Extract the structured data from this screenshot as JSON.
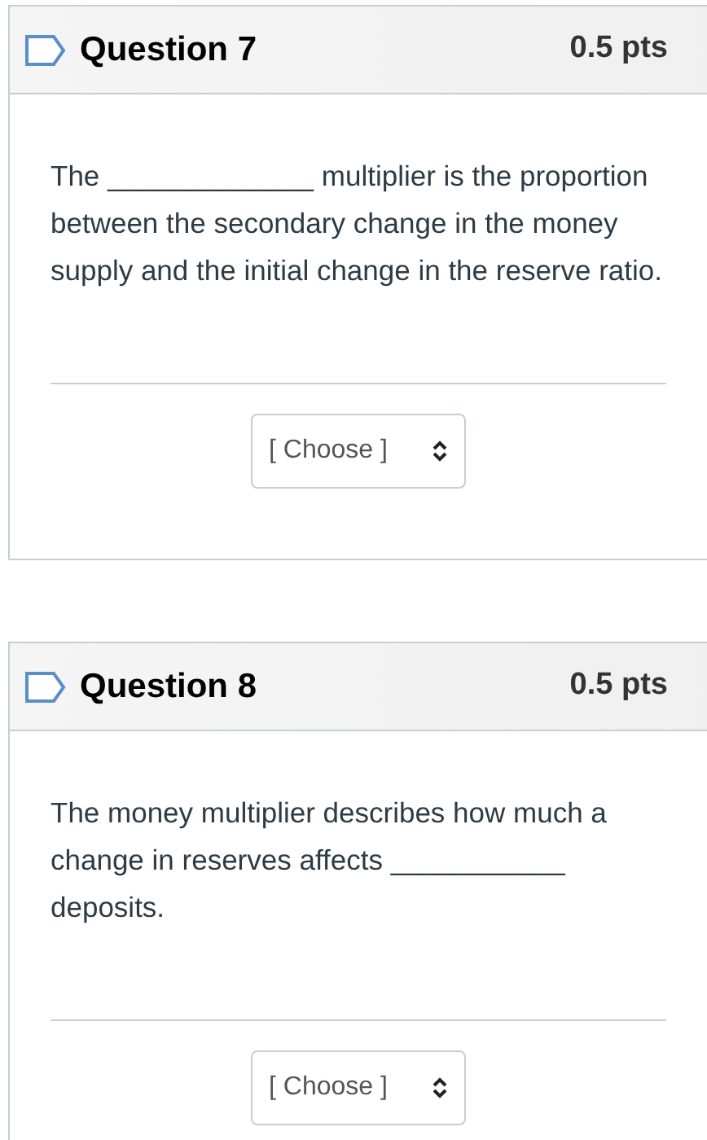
{
  "questions": [
    {
      "title": "Question 7",
      "points": "0.5 pts",
      "text": "The _____________ multiplier is the proportion between the secondary change in the money supply and the initial change in the reserve ratio.",
      "answer": {
        "placeholder": "[ Choose ]"
      }
    },
    {
      "title": "Question 8",
      "points": "0.5 pts",
      "text": "The money multiplier describes how much a change in reserves affects ___________ deposits.",
      "answer": {
        "placeholder": "[ Choose ]"
      }
    }
  ]
}
